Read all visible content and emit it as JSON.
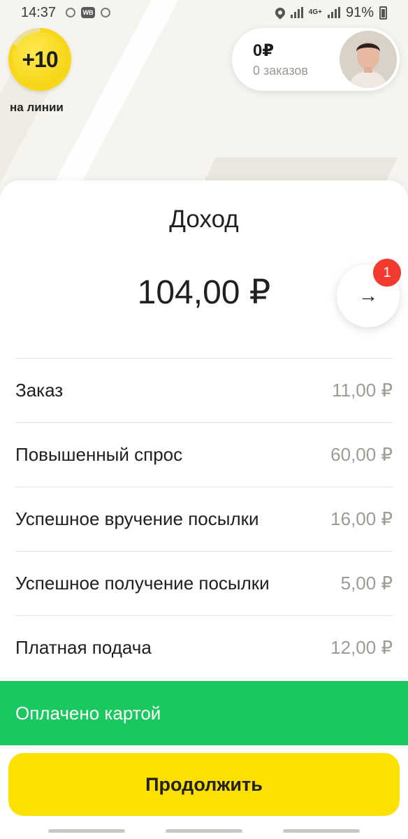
{
  "status_bar": {
    "time": "14:37",
    "app_badge": "WB",
    "network": "4G+",
    "battery": "91%"
  },
  "activity": {
    "value": "+10",
    "label": "на линии"
  },
  "earnings": {
    "amount": "0₽",
    "orders": "0 заказов"
  },
  "sheet": {
    "title": "Доход",
    "total": "104,00 ₽",
    "details_arrow": "→",
    "notification_count": "1"
  },
  "rows": [
    {
      "label": "Заказ",
      "value": "11,00 ₽"
    },
    {
      "label": "Повышенный спрос",
      "value": "60,00 ₽"
    },
    {
      "label": "Успешное вручение посылки",
      "value": "16,00 ₽"
    },
    {
      "label": "Успешное получение посылки",
      "value": "5,00 ₽"
    },
    {
      "label": "Платная подача",
      "value": "12,00 ₽"
    }
  ],
  "payment": {
    "label": "Оплачено картой"
  },
  "actions": {
    "continue_label": "Продолжить"
  },
  "colors": {
    "brand_yellow": "#fce000",
    "paid_green": "#19c85f",
    "badge_red": "#f23a2f"
  }
}
